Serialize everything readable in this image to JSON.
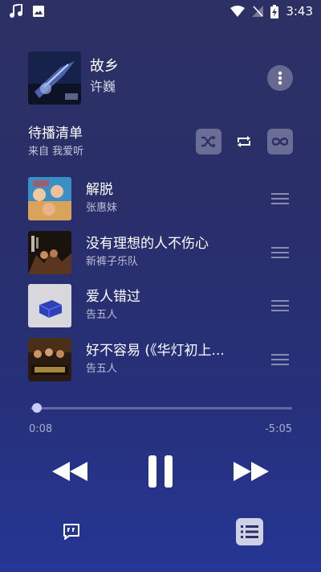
{
  "status_bar": {
    "time": "3:43",
    "icons": [
      "music-note-icon",
      "image-icon",
      "wifi-icon",
      "no-signal-icon",
      "battery-charging-icon"
    ]
  },
  "now_playing": {
    "title": "故乡",
    "artist": "许巍",
    "more_icon": "more-vertical-icon"
  },
  "queue": {
    "title": "待播清单",
    "source": "来自 我爱听",
    "buttons": [
      "shuffle-icon",
      "repeat-icon",
      "infinite-icon"
    ],
    "items": [
      {
        "title": "解脱",
        "artist": "张惠妹"
      },
      {
        "title": "没有理想的人不伤心",
        "artist": "新裤子乐队"
      },
      {
        "title": "爱人错过",
        "artist": "告五人"
      },
      {
        "title": "好不容易 (《华灯初上...",
        "artist": "告五人"
      }
    ]
  },
  "playback": {
    "elapsed": "0:08",
    "remaining": "-5:05",
    "progress_fraction": 0.025
  },
  "controls": [
    "rewind-icon",
    "pause-icon",
    "fast-forward-icon"
  ],
  "bottom": [
    "lyrics-icon",
    "queue-list-icon"
  ],
  "colors": {
    "background_top": "#2c3064",
    "background_bottom": "#253694",
    "accent": "#c8cdfc"
  }
}
